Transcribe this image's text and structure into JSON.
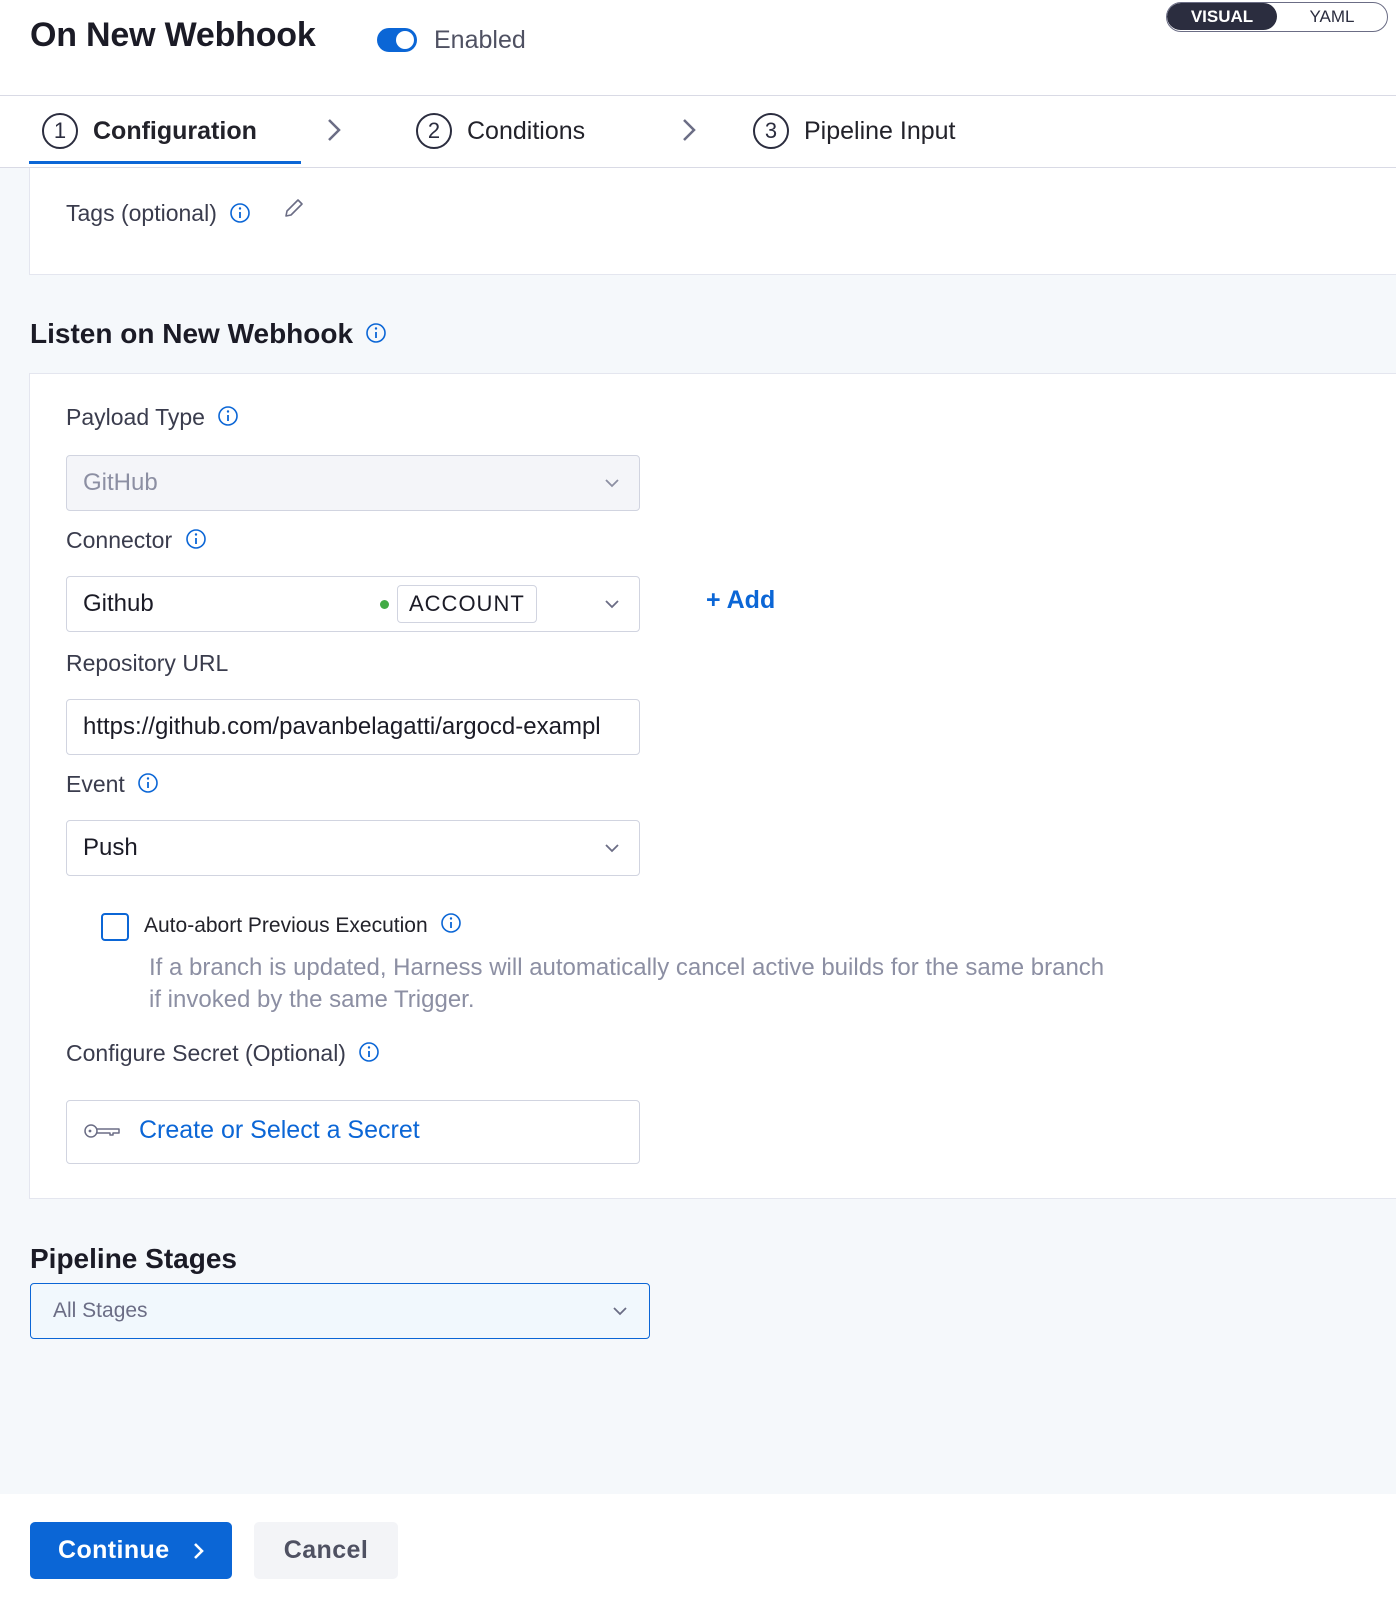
{
  "header": {
    "title": "On New Webhook",
    "toggle_label": "Enabled",
    "toggle_on": true,
    "view_options": [
      "VISUAL",
      "YAML"
    ],
    "active_view": "VISUAL"
  },
  "stepper": {
    "steps": [
      {
        "num": "1",
        "label": "Configuration",
        "active": true
      },
      {
        "num": "2",
        "label": "Conditions",
        "active": false
      },
      {
        "num": "3",
        "label": "Pipeline Input",
        "active": false
      }
    ]
  },
  "tags": {
    "label": "Tags (optional)",
    "icons": [
      "info-icon",
      "pencil-icon"
    ]
  },
  "listen": {
    "section_title": "Listen on New Webhook",
    "payload_type": {
      "label": "Payload Type",
      "value": "GitHub"
    },
    "connector": {
      "label": "Connector",
      "value": "Github",
      "scope_badge": "ACCOUNT",
      "status_color": "#42ab45",
      "add_label": "+ Add"
    },
    "repository_url": {
      "label": "Repository URL",
      "value": "https://github.com/pavanbelagatti/argocd-exampl"
    },
    "event": {
      "label": "Event",
      "value": "Push"
    },
    "auto_abort": {
      "label": "Auto-abort Previous Execution",
      "checked": false,
      "helper_line1": "If a branch is updated, Harness will automatically cancel active builds for the same branch",
      "helper_line2": "if invoked by the same Trigger."
    },
    "secret": {
      "label": "Configure Secret (Optional)",
      "link_text": "Create or Select a Secret"
    }
  },
  "pipeline_stages": {
    "title": "Pipeline Stages",
    "placeholder": "All Stages"
  },
  "footer": {
    "continue_label": "Continue",
    "cancel_label": "Cancel"
  },
  "colors": {
    "accent": "#0b66d6",
    "status_green": "#42ab45",
    "page_bg": "#f5f8fb"
  }
}
